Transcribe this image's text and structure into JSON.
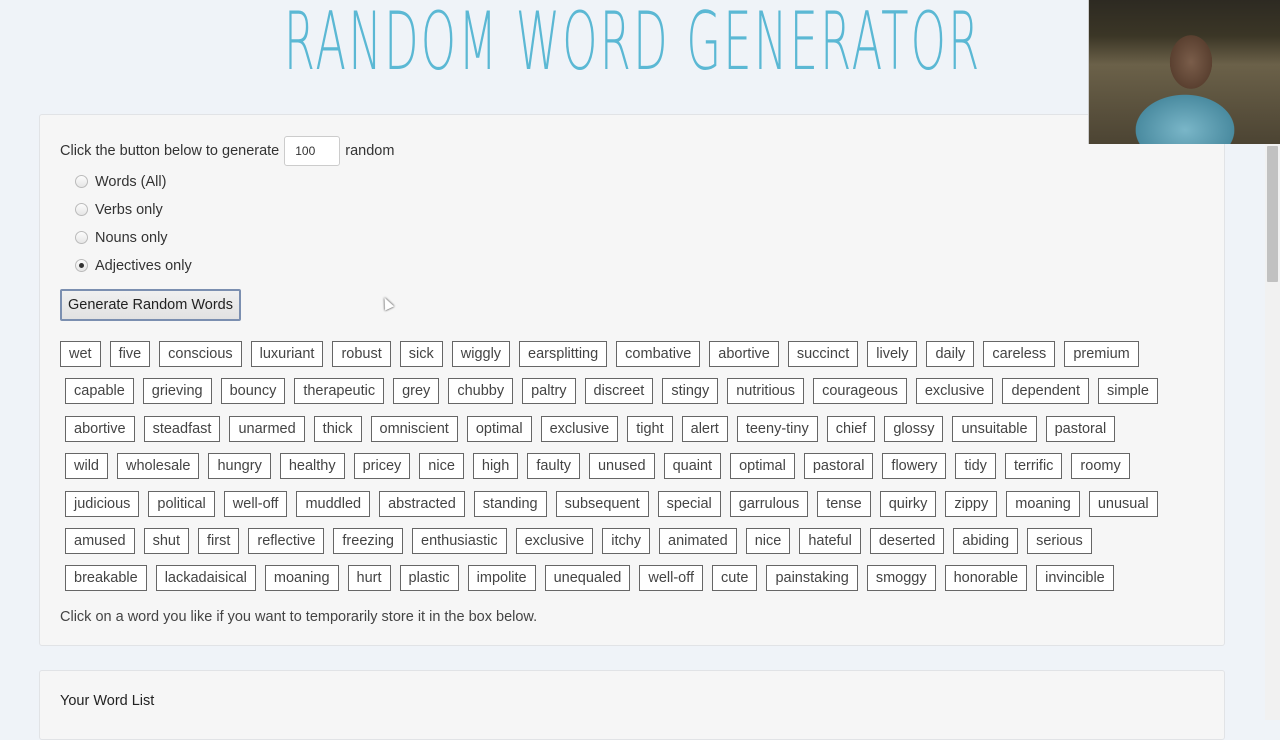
{
  "header": {
    "title": "RANDOM WORD GENERATOR"
  },
  "generator": {
    "intro_before": "Click the button below to generate",
    "count_value": "100",
    "intro_after": "random",
    "options": [
      {
        "label": "Words (All)",
        "checked": false
      },
      {
        "label": "Verbs only",
        "checked": false
      },
      {
        "label": "Nouns only",
        "checked": false
      },
      {
        "label": "Adjectives only",
        "checked": true
      }
    ],
    "generate_button": "Generate Random Words",
    "hint": "Click on a word you like if you want to temporarily store it in the box below."
  },
  "word_rows": [
    [
      "wet",
      "five",
      "conscious",
      "luxuriant",
      "robust",
      "sick",
      "wiggly",
      "earsplitting",
      "combative",
      "abortive",
      "succinct",
      "lively",
      "daily",
      "careless",
      "premium"
    ],
    [
      "capable",
      "grieving",
      "bouncy",
      "therapeutic",
      "grey",
      "chubby",
      "paltry",
      "discreet",
      "stingy",
      "nutritious",
      "courageous",
      "exclusive",
      "dependent",
      "simple"
    ],
    [
      "abortive",
      "steadfast",
      "unarmed",
      "thick",
      "omniscient",
      "optimal",
      "exclusive",
      "tight",
      "alert",
      "teeny-tiny",
      "chief",
      "glossy",
      "unsuitable",
      "pastoral"
    ],
    [
      "wild",
      "wholesale",
      "hungry",
      "healthy",
      "pricey",
      "nice",
      "high",
      "faulty",
      "unused",
      "quaint",
      "optimal",
      "pastoral",
      "flowery",
      "tidy",
      "terrific",
      "roomy"
    ],
    [
      "judicious",
      "political",
      "well-off",
      "muddled",
      "abstracted",
      "standing",
      "subsequent",
      "special",
      "garrulous",
      "tense",
      "quirky",
      "zippy",
      "moaning",
      "unusual"
    ],
    [
      "amused",
      "shut",
      "first",
      "reflective",
      "freezing",
      "enthusiastic",
      "exclusive",
      "itchy",
      "animated",
      "nice",
      "hateful",
      "deserted",
      "abiding",
      "serious"
    ],
    [
      "breakable",
      "lackadaisical",
      "moaning",
      "hurt",
      "plastic",
      "impolite",
      "unequaled",
      "well-off",
      "cute",
      "painstaking",
      "smoggy",
      "honorable",
      "invincible"
    ]
  ],
  "word_list": {
    "title": "Your Word List"
  },
  "overlay": {
    "webcam": "webcam-feed"
  }
}
